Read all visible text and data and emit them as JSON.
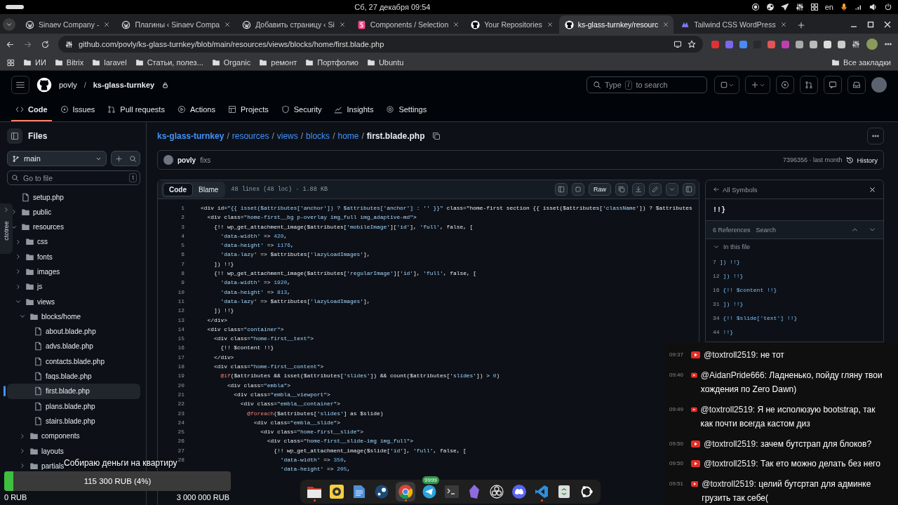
{
  "system_bar": {
    "datetime": "Сб, 27 декабря  09:54",
    "keyboard_layout": "en"
  },
  "browser": {
    "tabs": [
      {
        "title": "Sinaev Company -",
        "kind": "wordpress",
        "selected": false
      },
      {
        "title": "Плагины ‹ Sinaev Compa",
        "kind": "wordpress",
        "selected": false
      },
      {
        "title": "Добавить страницу ‹ Si",
        "kind": "wordpress",
        "selected": false
      },
      {
        "title": "Components / Selection",
        "kind": "storybook",
        "selected": false
      },
      {
        "title": "Your Repositories",
        "kind": "github",
        "selected": false
      },
      {
        "title": "ks-glass-turnkey/resourc",
        "kind": "github",
        "selected": true
      },
      {
        "title": "Tailwind CSS WordPress",
        "kind": "tailwind",
        "selected": false
      }
    ],
    "address": "github.com/povly/ks-glass-turnkey/blob/main/resources/views/blocks/home/first.blade.php",
    "bookmarks": [
      {
        "label": "ИИ"
      },
      {
        "label": "Bitrix"
      },
      {
        "label": "laravel"
      },
      {
        "label": "Статьи, полез..."
      },
      {
        "label": "Organic"
      },
      {
        "label": "ремонт"
      },
      {
        "label": "Портфолио"
      },
      {
        "label": "Ubuntu"
      }
    ],
    "all_bookmarks": "Все закладки"
  },
  "github": {
    "owner": "povly",
    "separator": "/",
    "repo": "ks-glass-turnkey",
    "search": {
      "prefix": "Type",
      "key": "/",
      "suffix": "to search"
    },
    "nav": [
      {
        "label": "Code",
        "kind": "code",
        "selected": true
      },
      {
        "label": "Issues",
        "kind": "issues",
        "selected": false
      },
      {
        "label": "Pull requests",
        "kind": "pulls",
        "selected": false
      },
      {
        "label": "Actions",
        "kind": "actions",
        "selected": false
      },
      {
        "label": "Projects",
        "kind": "projects",
        "selected": false
      },
      {
        "label": "Security",
        "kind": "security",
        "selected": false
      },
      {
        "label": "Insights",
        "kind": "insights",
        "selected": false
      },
      {
        "label": "Settings",
        "kind": "settings",
        "selected": false
      }
    ]
  },
  "sidebar": {
    "title": "Files",
    "branch": "main",
    "go_to_file": {
      "placeholder": "Go to file",
      "shortcut": "t"
    },
    "tree": [
      {
        "name": "setup.php",
        "kind": "file",
        "selected": false
      },
      {
        "name": "public",
        "kind": "folder",
        "expanded": false,
        "selected": false
      },
      {
        "name": "resources",
        "kind": "folder",
        "expanded": true,
        "selected": false,
        "children": [
          {
            "name": "css",
            "kind": "folder",
            "expanded": false,
            "selected": false
          },
          {
            "name": "fonts",
            "kind": "folder",
            "expanded": false,
            "selected": false
          },
          {
            "name": "images",
            "kind": "folder",
            "expanded": false,
            "selected": false
          },
          {
            "name": "js",
            "kind": "folder",
            "expanded": false,
            "selected": false
          },
          {
            "name": "views",
            "kind": "folder",
            "expanded": true,
            "selected": false,
            "children": [
              {
                "name": "blocks/home",
                "kind": "folder",
                "expanded": true,
                "selected": false,
                "children": [
                  {
                    "name": "about.blade.php",
                    "kind": "file",
                    "selected": false
                  },
                  {
                    "name": "advs.blade.php",
                    "kind": "file",
                    "selected": false
                  },
                  {
                    "name": "contacts.blade.php",
                    "kind": "file",
                    "selected": false
                  },
                  {
                    "name": "faqs.blade.php",
                    "kind": "file",
                    "selected": false
                  },
                  {
                    "name": "first.blade.php",
                    "kind": "file",
                    "selected": true
                  },
                  {
                    "name": "plans.blade.php",
                    "kind": "file",
                    "selected": false
                  },
                  {
                    "name": "stairs.blade.php",
                    "kind": "file",
                    "selected": false
                  }
                ]
              },
              {
                "name": "components",
                "kind": "folder",
                "expanded": false,
                "selected": false
              },
              {
                "name": "layouts",
                "kind": "folder",
                "expanded": false,
                "selected": false
              },
              {
                "name": "partials",
                "kind": "folder",
                "expanded": false,
                "selected": false
              }
            ]
          }
        ]
      }
    ]
  },
  "octotree": {
    "label": "ctotree"
  },
  "breadcrumb": {
    "separator": "/",
    "items": [
      {
        "label": "ks-glass-turnkey",
        "kind": "repo"
      },
      {
        "label": "resources",
        "kind": "dir"
      },
      {
        "label": "views",
        "kind": "dir"
      },
      {
        "label": "blocks",
        "kind": "dir"
      },
      {
        "label": "home",
        "kind": "dir"
      },
      {
        "label": "first.blade.php",
        "kind": "file"
      }
    ]
  },
  "commit": {
    "author": "povly",
    "message": "fixs",
    "meta": "7396356 · last month",
    "history": "History"
  },
  "file": {
    "tabs": [
      {
        "label": "Code",
        "selected": true
      },
      {
        "label": "Blame",
        "selected": false
      }
    ],
    "info": "48 lines (48 loc) · 1.88 KB",
    "raw": "Raw",
    "lines": [
      {
        "number": "1",
        "text": "<div id=\"{{ isset($attributes['anchor']) ? $attributes['anchor'] : '' }}\" class=\"home-first section {{ isset($attributes['className']) ? $attributes"
      },
      {
        "number": "2",
        "text": "  <div class=\"home-first__bg p-overlay img_full img_adaptive-md\">"
      },
      {
        "number": "3",
        "text": "    {!! wp_get_attachment_image($attributes['mobileImage']['id'], 'full', false, ["
      },
      {
        "number": "4",
        "text": "      'data-width' => 420,"
      },
      {
        "number": "5",
        "text": "      'data-height' => 1176,"
      },
      {
        "number": "6",
        "text": "      'data-lazy' => $attributes['lazyLoadImages'],"
      },
      {
        "number": "7",
        "text": "    ]) !!}"
      },
      {
        "number": "8",
        "text": "    {!! wp_get_attachment_image($attributes['regularImage']['id'], 'full', false, ["
      },
      {
        "number": "9",
        "text": "      'data-width' => 1920,"
      },
      {
        "number": "10",
        "text": "      'data-height' => 813,"
      },
      {
        "number": "11",
        "text": "      'data-lazy' => $attributes['lazyLoadImages'],"
      },
      {
        "number": "12",
        "text": "    ]) !!}"
      },
      {
        "number": "13",
        "text": "  </div>"
      },
      {
        "number": "14",
        "text": "  <div class=\"container\">"
      },
      {
        "number": "15",
        "text": "    <div class=\"home-first__text\">"
      },
      {
        "number": "16",
        "text": "      {!! $content !!}"
      },
      {
        "number": "17",
        "text": "    </div>"
      },
      {
        "number": "18",
        "text": "    <div class=\"home-first__content\">"
      },
      {
        "number": "19",
        "text": "      @if($attributes && isset($attributes['slides']) && count($attributes['slides']) > 0)"
      },
      {
        "number": "20",
        "text": "        <div class=\"embla\">"
      },
      {
        "number": "21",
        "text": "          <div class=\"embla__viewport\">"
      },
      {
        "number": "22",
        "text": "            <div class=\"embla__container\">"
      },
      {
        "number": "23",
        "text": "              @foreach($attributes['slides'] as $slide)"
      },
      {
        "number": "24",
        "text": "                <div class=\"embla__slide\">"
      },
      {
        "number": "25",
        "text": "                  <div class=\"home-first__slide\">"
      },
      {
        "number": "26",
        "text": "                    <div class=\"home-first__slide-img img_full\">"
      },
      {
        "number": "27",
        "text": "                      {!! wp_get_attachment_image($slide['id'], 'full', false, ["
      },
      {
        "number": "28",
        "text": "                        'data-width' => 350,"
      },
      {
        "text": "                        'data-height' => 205,"
      }
    ]
  },
  "symbols": {
    "title": "All Symbols",
    "symbol": "!!}",
    "references": "6 References",
    "search": "Search",
    "group": {
      "label": "In this file",
      "expanded": true
    },
    "items": [
      {
        "line": "7",
        "text": "]) !!}"
      },
      {
        "line": "12",
        "text": "]) !!}"
      },
      {
        "line": "16",
        "text": "{!! $content !!}"
      },
      {
        "line": "31",
        "text": "]) !!}"
      },
      {
        "line": "34",
        "text": "{!! $slide['text'] !!}"
      },
      {
        "line": "44",
        "text": "!!}"
      }
    ]
  },
  "chat": [
    {
      "time": "09:37",
      "author": "@toxtroll2519:",
      "text": "не тот"
    },
    {
      "time": "09:40",
      "author": "@AidanPride666:",
      "text": "Ладненько, пойду гляну твои хождения по Zero Dawn)"
    },
    {
      "time": "09:49",
      "author": "@toxtroll2519:",
      "text": "Я не исполюзую bootstrap, так как почти всегда кастом диз"
    },
    {
      "time": "09:50",
      "author": "@toxtroll2519:",
      "text": "зачем бутстрап для блоков?"
    },
    {
      "time": "09:50",
      "author": "@toxtroll2519:",
      "text": "Так ето можно делать без него"
    },
    {
      "time": "09:51",
      "author": "@toxtroll2519:",
      "text": "целий бутсртап для админке грузить так себе("
    }
  ],
  "donation": {
    "title": "Собираю деньги на квартиру",
    "level": 0.04,
    "reading": "115 300 RUB (4%)",
    "min": "0 RUB",
    "max": "3 000 000 RUB"
  },
  "dock": {
    "badge": "9999"
  }
}
